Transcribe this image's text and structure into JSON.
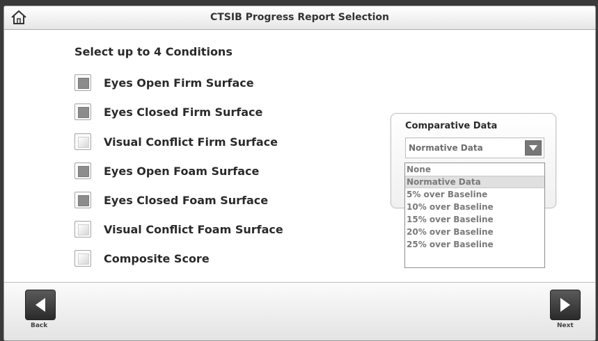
{
  "header": {
    "title": "CTSIB Progress Report Selection",
    "home_icon": "home-icon"
  },
  "conditions": {
    "heading": "Select up to 4 Conditions",
    "items": [
      {
        "label": "Eyes Open Firm Surface",
        "checked": true
      },
      {
        "label": "Eyes Closed Firm Surface",
        "checked": true
      },
      {
        "label": "Visual Conflict Firm Surface",
        "checked": false
      },
      {
        "label": "Eyes Open Foam Surface",
        "checked": true
      },
      {
        "label": "Eyes Closed Foam Surface",
        "checked": true
      },
      {
        "label": "Visual Conflict Foam Surface",
        "checked": false
      },
      {
        "label": "Composite Score",
        "checked": false
      }
    ]
  },
  "comparative": {
    "label": "Comparative Data",
    "selected": "Normative Data",
    "options": [
      "None",
      "Normative Data",
      "5% over Baseline",
      "10% over Baseline",
      "15% over Baseline",
      "20% over Baseline",
      "25% over Baseline"
    ]
  },
  "footer": {
    "back_label": "Back",
    "next_label": "Next"
  },
  "colors": {
    "checked_fill": "#8c8c8c",
    "button_dark": "#2a2a2a"
  }
}
